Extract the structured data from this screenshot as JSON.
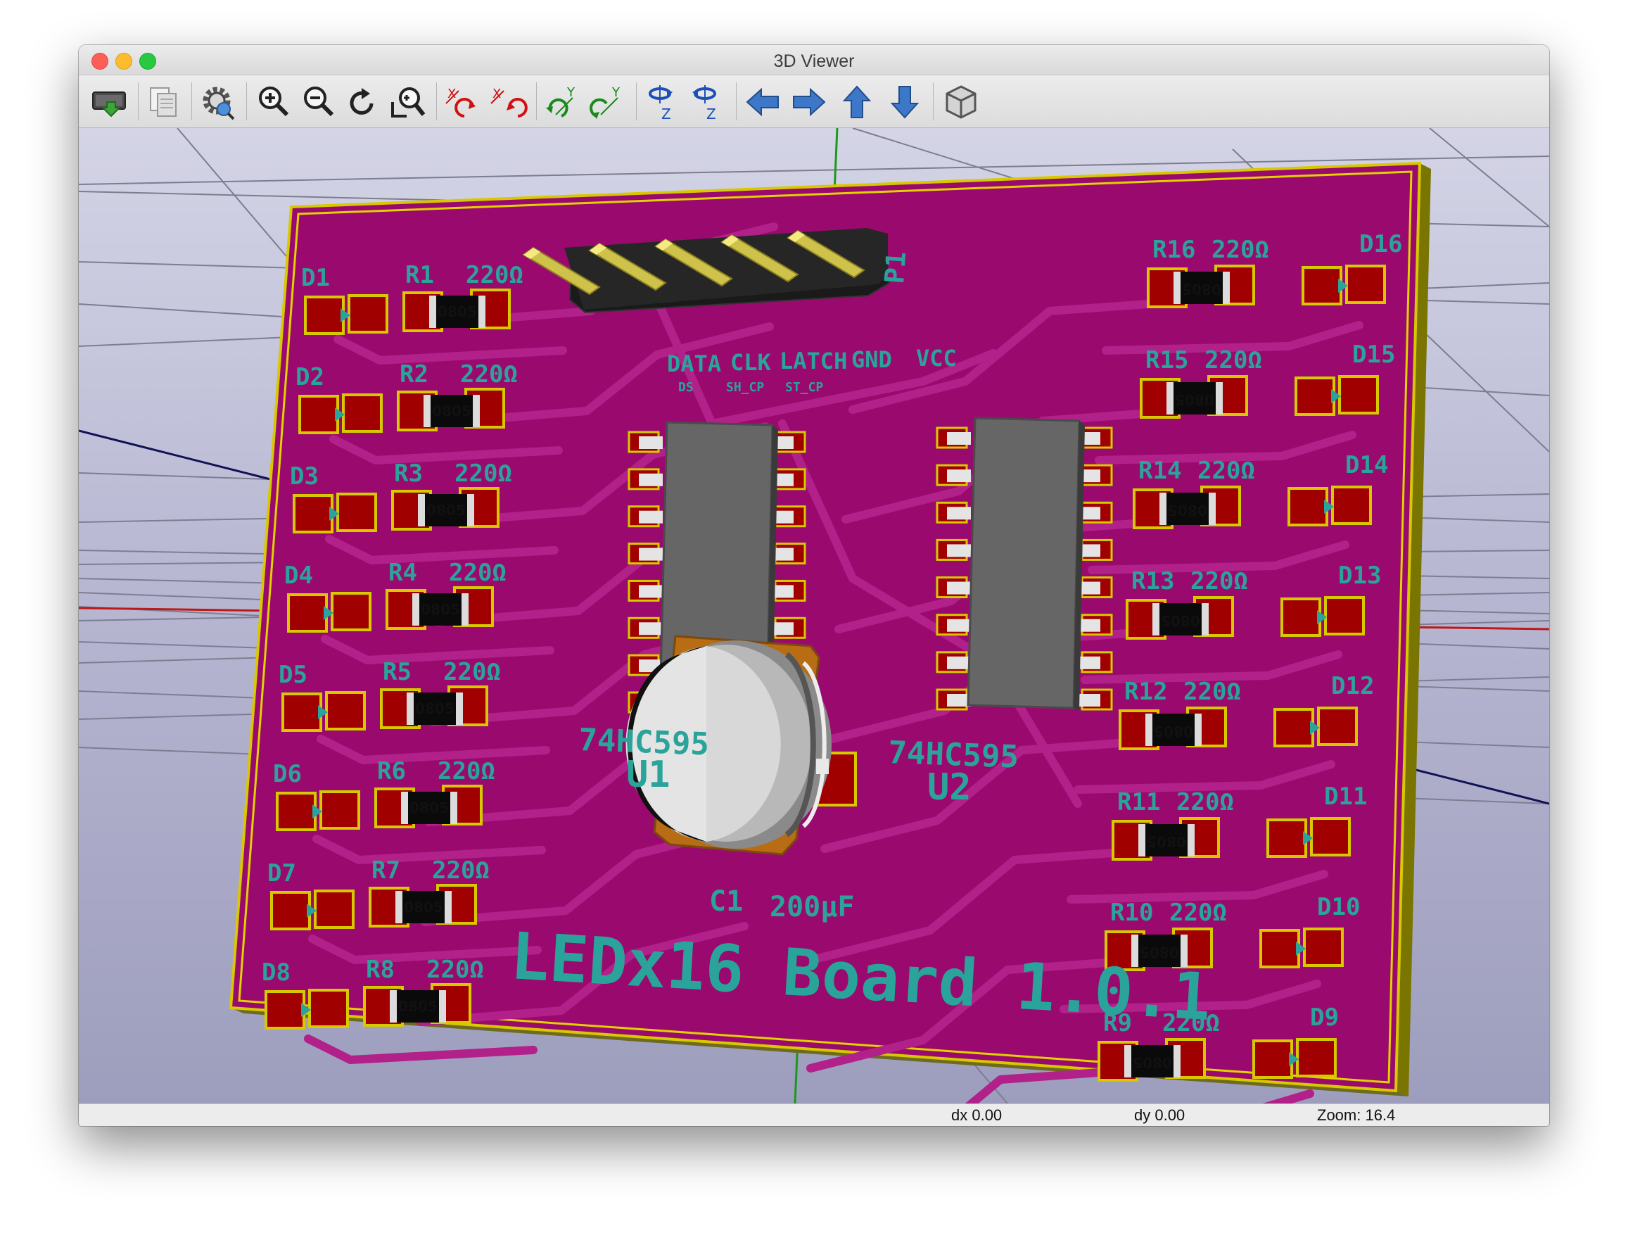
{
  "window": {
    "title": "3D Viewer"
  },
  "toolbar": {
    "buttons": [
      {
        "name": "export-image-button",
        "icon": "export-board-icon"
      },
      {
        "name": "copy-to-clipboard-button",
        "icon": "copy-icon"
      },
      {
        "name": "settings-button",
        "icon": "gear-icon"
      },
      {
        "name": "zoom-in-button",
        "icon": "zoom-in-icon"
      },
      {
        "name": "zoom-out-icon-button",
        "icon": "zoom-out-icon"
      },
      {
        "name": "redraw-button",
        "icon": "redraw-icon"
      },
      {
        "name": "zoom-fit-button",
        "icon": "zoom-fit-icon"
      },
      {
        "name": "rotate-x-cw-button",
        "icon": "rotate-x-icon"
      },
      {
        "name": "rotate-x-ccw-button",
        "icon": "rotate-x-icon"
      },
      {
        "name": "rotate-y-cw-button",
        "icon": "rotate-y-icon"
      },
      {
        "name": "rotate-y-ccw-button",
        "icon": "rotate-y-icon"
      },
      {
        "name": "rotate-z-cw-button",
        "icon": "rotate-z-icon"
      },
      {
        "name": "rotate-z-ccw-button",
        "icon": "rotate-z-icon"
      },
      {
        "name": "move-left-button",
        "icon": "arrow-left-icon"
      },
      {
        "name": "move-right-button",
        "icon": "arrow-right-icon"
      },
      {
        "name": "move-up-button",
        "icon": "arrow-up-icon"
      },
      {
        "name": "move-down-button",
        "icon": "arrow-down-icon"
      },
      {
        "name": "ortho-toggle-button",
        "icon": "cube-icon"
      }
    ],
    "axis_letters": {
      "x": "X",
      "y": "Y",
      "z": "Z"
    }
  },
  "board": {
    "title_text": "LEDx16 Board 1.0.1",
    "connector": {
      "ref": "P1",
      "pins": [
        "DATA",
        "CLK",
        "LATCH",
        "GND",
        "VCC"
      ],
      "sub_labels": [
        "DS",
        "SH_CP",
        "ST_CP"
      ]
    },
    "ics": [
      {
        "ref": "U1",
        "value": "74HC595"
      },
      {
        "ref": "U2",
        "value": "74HC595"
      }
    ],
    "capacitor": {
      "ref": "C1",
      "value": "200µF"
    },
    "resistor_value": "220Ω",
    "resistor_package": "0805",
    "left_leds": [
      {
        "d": "D1",
        "r": "R1"
      },
      {
        "d": "D2",
        "r": "R2"
      },
      {
        "d": "D3",
        "r": "R3"
      },
      {
        "d": "D4",
        "r": "R4"
      },
      {
        "d": "D5",
        "r": "R5"
      },
      {
        "d": "D6",
        "r": "R6"
      },
      {
        "d": "D7",
        "r": "R7"
      },
      {
        "d": "D8",
        "r": "R8"
      }
    ],
    "right_leds": [
      {
        "d": "D16",
        "r": "R16"
      },
      {
        "d": "D15",
        "r": "R15"
      },
      {
        "d": "D14",
        "r": "R14"
      },
      {
        "d": "D13",
        "r": "R13"
      },
      {
        "d": "D12",
        "r": "R12"
      },
      {
        "d": "D11",
        "r": "R11"
      },
      {
        "d": "D10",
        "r": "R10"
      },
      {
        "d": "D9",
        "r": "R9"
      }
    ],
    "colors": {
      "board": "#9a0a6e",
      "pad": "#a00000",
      "silk": "#2aa49a",
      "outline": "#d8c800",
      "edge": "#7a7400"
    }
  },
  "status": {
    "dx": "dx 0.00",
    "dy": "dy 0.00",
    "zoom": "Zoom: 16.4"
  }
}
